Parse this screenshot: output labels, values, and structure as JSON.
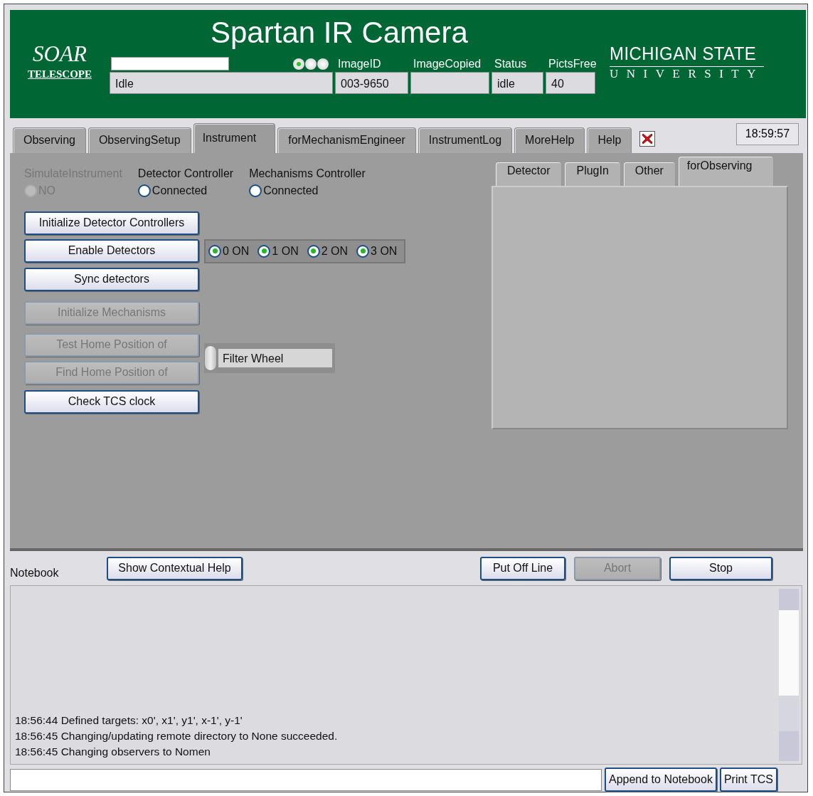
{
  "header": {
    "logo_top": "SOAR",
    "logo_bottom": "TELESCOPE",
    "title": "Spartan IR Camera",
    "lights": [
      {
        "on": true
      },
      {
        "on": false
      },
      {
        "on": false
      }
    ],
    "message": "Idle",
    "fields": [
      {
        "label": "ImageID",
        "value": "003-9650"
      },
      {
        "label": "ImageCopied"
      },
      {
        "label": "Status",
        "value": "idle"
      },
      {
        "label": "PictsFree",
        "value": "40"
      }
    ],
    "university": [
      "MICHIGAN STATE",
      "UNIVERSITY"
    ]
  },
  "tabs": [
    {
      "label": "Observing",
      "selected": false
    },
    {
      "label": "ObservingSetup",
      "selected": false
    },
    {
      "label": "Instrument",
      "selected": true
    },
    {
      "label": "forMechanismEngineer",
      "selected": false
    },
    {
      "label": "InstrumentLog",
      "selected": false
    },
    {
      "label": "MoreHelp",
      "selected": false
    },
    {
      "label": "Help",
      "selected": false
    }
  ],
  "clock": "18:59:57",
  "instrument": {
    "toggles": [
      {
        "label": "SimulateInstrument",
        "option": "NO",
        "checked": false,
        "disabled": true
      },
      {
        "label": "Detector Controller",
        "option": "Connected",
        "checked": false,
        "disabled": false
      },
      {
        "label": "Mechanisms Controller",
        "option": "Connected",
        "checked": false,
        "disabled": false
      }
    ],
    "buttons": [
      {
        "label": "Initialize Detector Controllers",
        "disabled": false
      },
      {
        "label": "Enable Detectors",
        "disabled": false
      },
      {
        "label": "Sync detectors",
        "disabled": false
      },
      {
        "label": "Initialize Mechanisms",
        "disabled": true
      },
      {
        "label": "Test Home Position of",
        "disabled": true
      },
      {
        "label": "Find Home Position of",
        "disabled": true
      },
      {
        "label": "Check TCS clock",
        "disabled": false
      }
    ],
    "detectors": [
      {
        "label": "0 ON",
        "checked": true
      },
      {
        "label": "1 ON",
        "checked": true
      },
      {
        "label": "2 ON",
        "checked": true
      },
      {
        "label": "3 ON",
        "checked": true
      }
    ],
    "mechanism": "Filter Wheel",
    "subtabs": [
      {
        "label": "Detector",
        "selected": false
      },
      {
        "label": "PlugIn",
        "selected": false
      },
      {
        "label": "Other",
        "selected": false
      },
      {
        "label": "forObserving",
        "selected": true
      }
    ]
  },
  "notebook": {
    "label": "Notebook",
    "buttons": [
      {
        "label": "Show Contextual Help",
        "disabled": false
      },
      {
        "label": "Put Off Line",
        "disabled": false
      },
      {
        "label": "Abort",
        "disabled": true
      },
      {
        "label": "Stop",
        "disabled": false
      }
    ],
    "log": [
      "18:56:44 Defined targets: x0', x1', y1', x-1', y-1'",
      "18:56:45 Changing/updating remote directory to None succeeded.",
      "18:56:45 Changing observers to Nomen"
    ],
    "append_button": "Append to Notebook",
    "print_button": "Print TCS"
  }
}
